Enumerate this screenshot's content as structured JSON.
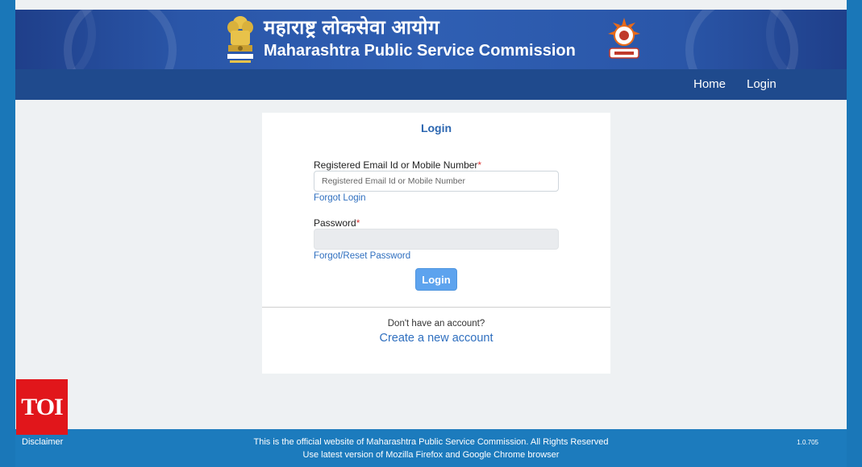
{
  "header": {
    "title_hindi": "महाराष्ट्र लोकसेवा आयोग",
    "title_english": "Maharashtra Public Service Commission",
    "emblem_icon": "national-emblem-icon",
    "seal_icon": "mpsc-seal-icon"
  },
  "nav": {
    "home": "Home",
    "login": "Login"
  },
  "login_card": {
    "title": "Login",
    "email_label": "Registered Email Id or Mobile Number",
    "required_marker": "*",
    "email_placeholder": "Registered Email Id or Mobile Number",
    "email_value": "",
    "forgot_login": "Forgot Login",
    "password_label": "Password",
    "password_value": "",
    "forgot_password": "Forgot/Reset Password",
    "login_button": "Login",
    "no_account_text": "Don't have an account?",
    "create_account": "Create a new account"
  },
  "footer": {
    "disclaimer": "Disclaimer",
    "line1": "This is the official website of Maharashtra Public Service Commission. All Rights Reserved",
    "line2": "Use latest version of Mozilla Firefox and Google Chrome browser",
    "version": "1.0.705"
  },
  "watermark": {
    "text": "TOI"
  },
  "colors": {
    "banner": "#2a56a8",
    "navbar": "#1f4a8d",
    "footer": "#1c7bbd",
    "link": "#2f6fbf",
    "button": "#5da3ee",
    "toi": "#e1161b"
  }
}
